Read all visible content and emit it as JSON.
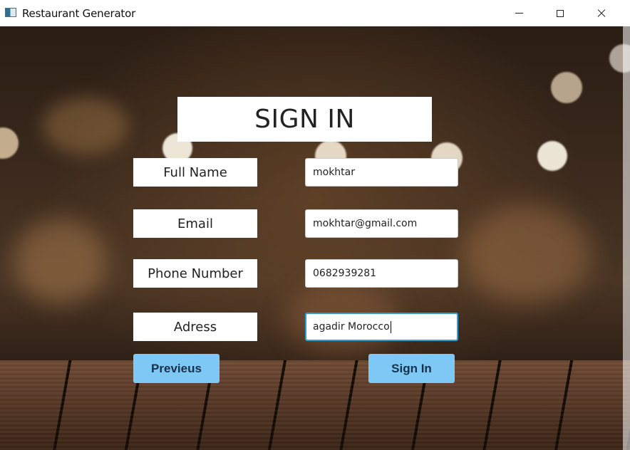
{
  "window": {
    "title": "Restaurant Generator",
    "controls": [
      "minimize-icon",
      "maximize-icon",
      "close-icon"
    ]
  },
  "form": {
    "heading": "SIGN IN",
    "fields": [
      {
        "label": "Full Name",
        "value": "mokhtar"
      },
      {
        "label": "Email",
        "value": "mokhtar@gmail.com"
      },
      {
        "label": "Phone Number",
        "value": "0682939281"
      },
      {
        "label": "Adress",
        "value": "agadir Morocco"
      }
    ],
    "buttons": {
      "previous": "Previeus",
      "sign_in": "Sign In"
    }
  },
  "colors": {
    "button_bg": "#7ec8f5",
    "focus_border": "#2a9fd6"
  }
}
